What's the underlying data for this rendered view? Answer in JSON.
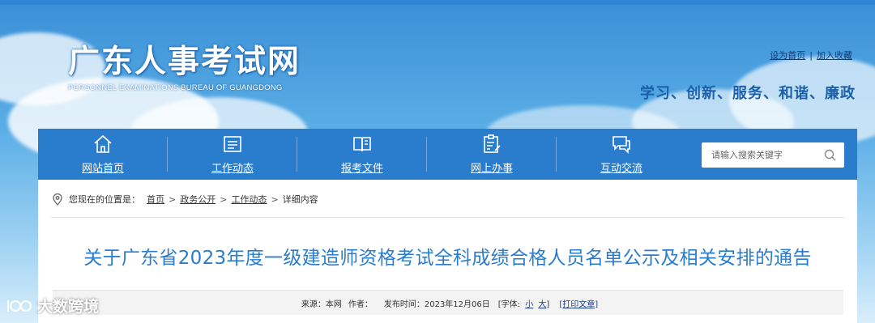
{
  "header": {
    "title_cn": "广东人事考试网",
    "title_en": "PERSONNEL EXAMINATIONS BUREAU OF GUANGDONG",
    "links": {
      "homepage": "设为首页",
      "sep": "|",
      "bookmark": "加入收藏"
    },
    "slogan": "学习、创新、服务、和谐、廉政"
  },
  "nav": {
    "items": [
      {
        "label": "网站首页",
        "icon": "home-icon"
      },
      {
        "label": "工作动态",
        "icon": "news-icon"
      },
      {
        "label": "报考文件",
        "icon": "book-icon"
      },
      {
        "label": "网上办事",
        "icon": "clipboard-icon"
      },
      {
        "label": "互动交流",
        "icon": "chat-icon"
      }
    ],
    "search": {
      "placeholder": "请输入搜索关键字",
      "icon": "search-icon"
    }
  },
  "breadcrumb": {
    "prefix": "您现在的位置是：",
    "items": [
      "首页",
      "政务公开",
      "工作动态",
      "详细内容"
    ],
    "sep": ">"
  },
  "article": {
    "title": "关于广东省2023年度一级建造师资格考试全科成绩合格人员名单公示及相关安排的通告",
    "meta": {
      "source_label": "来源：",
      "source": "本网",
      "author_label": "作者：",
      "date_label": "发布时间：",
      "date": "2023年12月06日",
      "font_label": "[字体:",
      "font_small": "小",
      "font_large": "大",
      "font_close": "]",
      "print": "[打印文章]"
    }
  },
  "watermark": {
    "text": "大数跨境"
  },
  "colors": {
    "nav_bg": "#2a7ccc",
    "title": "#2a7ccc",
    "slogan": "#1a5fa9"
  }
}
